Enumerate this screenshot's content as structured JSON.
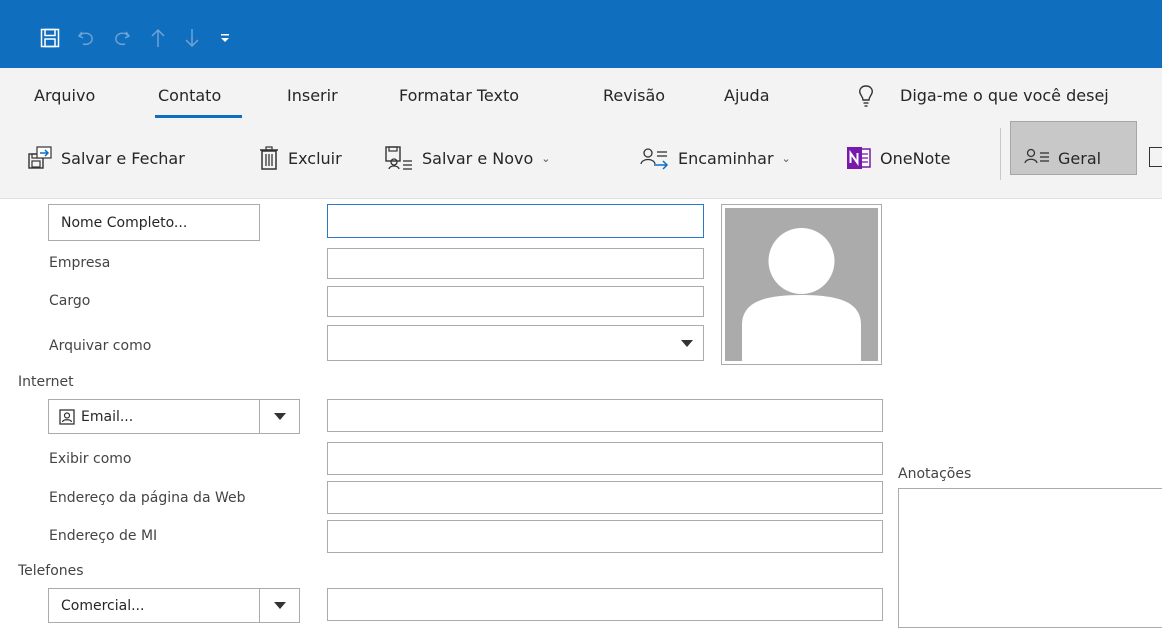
{
  "colors": {
    "titlebar": "#106ebe",
    "accent": "#106ebe",
    "ribbon_bg": "#f3f3f3"
  },
  "quick_access": [
    "save-icon",
    "undo-icon",
    "redo-icon",
    "up-arrow-icon",
    "down-arrow-icon",
    "customize-icon"
  ],
  "menu": {
    "tabs": [
      "Arquivo",
      "Contato",
      "Inserir",
      "Formatar Texto",
      "Revisão",
      "Ajuda"
    ],
    "active_tab": "Contato",
    "tell_me": "Diga-me o que você desej"
  },
  "ribbon": {
    "save_close": "Salvar e Fechar",
    "delete": "Excluir",
    "save_new": "Salvar e Novo",
    "forward": "Encaminhar",
    "onenote": "OneNote",
    "general": "Geral"
  },
  "form": {
    "full_name_button": "Nome Completo...",
    "full_name_value": "",
    "company_label": "Empresa",
    "job_title_label": "Cargo",
    "file_as_label": "Arquivar como",
    "internet_section": "Internet",
    "email_button": "Email...",
    "display_as_label": "Exibir como",
    "web_page_label": "Endereço da página da Web",
    "im_label": "Endereço de MI",
    "phones_section": "Telefones",
    "business_button": "Comercial...",
    "notes_label": "Anotações"
  }
}
